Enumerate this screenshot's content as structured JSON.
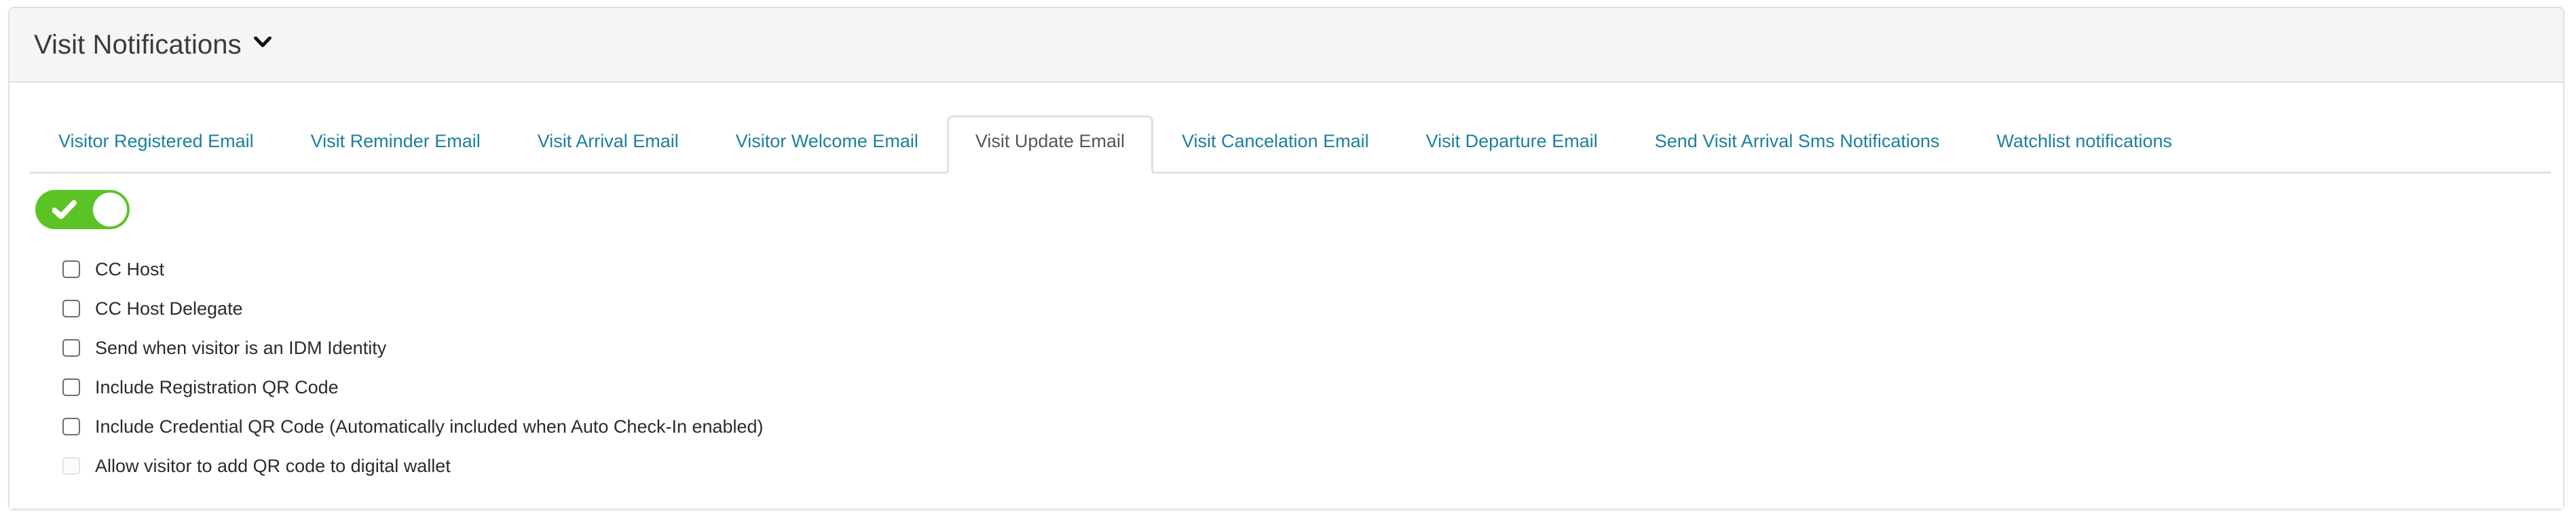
{
  "header": {
    "title": "Visit Notifications",
    "caret_icon": "chevron-down-icon"
  },
  "tabs": [
    {
      "label": "Visitor Registered Email",
      "active": false
    },
    {
      "label": "Visit Reminder Email",
      "active": false
    },
    {
      "label": "Visit Arrival Email",
      "active": false
    },
    {
      "label": "Visitor Welcome Email",
      "active": false
    },
    {
      "label": "Visit Update Email",
      "active": true
    },
    {
      "label": "Visit Cancelation Email",
      "active": false
    },
    {
      "label": "Visit Departure Email",
      "active": false
    },
    {
      "label": "Send Visit Arrival Sms Notifications",
      "active": false
    },
    {
      "label": "Watchlist notifications",
      "active": false
    }
  ],
  "toggle": {
    "name": "enable-notification-toggle",
    "state": "on",
    "check_icon": "check-icon"
  },
  "checkboxes": [
    {
      "label": "CC Host",
      "checked": false,
      "disabled": false
    },
    {
      "label": "CC Host Delegate",
      "checked": false,
      "disabled": false
    },
    {
      "label": "Send when visitor is an IDM Identity",
      "checked": false,
      "disabled": false
    },
    {
      "label": "Include Registration QR Code",
      "checked": false,
      "disabled": false
    },
    {
      "label": "Include Credential QR Code (Automatically included when Auto Check-In enabled)",
      "checked": false,
      "disabled": false
    },
    {
      "label": "Allow visitor to add QR code to digital wallet",
      "checked": false,
      "disabled": true
    }
  ],
  "colors": {
    "tab_link": "#1b7f9e",
    "tab_active_text": "#555555",
    "toggle_on": "#5cc327",
    "panel_border": "#e0e0e0",
    "header_bg": "#f5f5f5",
    "label_text": "#2b2b2b"
  }
}
